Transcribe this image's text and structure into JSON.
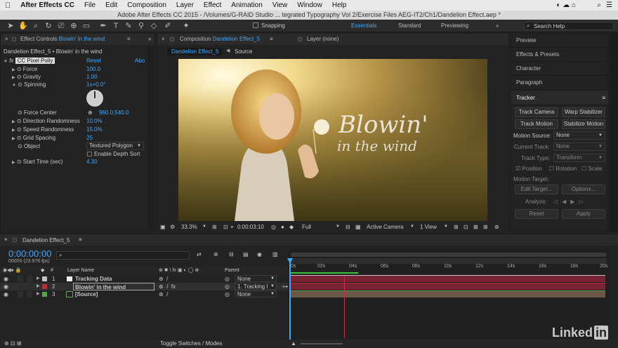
{
  "menu": {
    "app": "After Effects CC",
    "items": [
      "File",
      "Edit",
      "Composition",
      "Layer",
      "Effect",
      "Animation",
      "View",
      "Window",
      "Help"
    ]
  },
  "title_bar": "Adobe After Effects CC 2015 - /Volumes/G-RAID Studio ... tegrated Typography Vol 2/Exercise Files AEG-IT2/Ch1/Dandelion Effect.aep *",
  "toolbar": {
    "snapping_label": "Snapping",
    "workspaces": [
      "Essentials",
      "Standard",
      "Previewing"
    ],
    "search_placeholder": "Search Help"
  },
  "effect_controls": {
    "tab_label": "Effect Controls",
    "tab_layer": "Blowin' in the wind",
    "breadcrumb": "Dandelion Effect_5 • Blowin' in the wind",
    "effect_name": "CC Pixel Polly",
    "reset": "Reset",
    "about": "Abo",
    "props": [
      {
        "name": "Force",
        "value": "100.0"
      },
      {
        "name": "Gravity",
        "value": "1.00"
      },
      {
        "name": "Spinning",
        "value": "1x+0.0°"
      },
      {
        "name": "Force Center",
        "value": "960.0,540.0"
      },
      {
        "name": "Direction Randomness",
        "value": "10.0%"
      },
      {
        "name": "Speed Randomness",
        "value": "15.0%"
      },
      {
        "name": "Grid Spacing",
        "value": "25"
      },
      {
        "name": "Object",
        "value": "Textured Polygon"
      },
      {
        "name": "Enable Depth Sort",
        "value": ""
      },
      {
        "name": "Start Time (sec)",
        "value": "4.30"
      }
    ]
  },
  "composition": {
    "tab_label": "Composition",
    "tab_name": "Dandelion Effect_5",
    "layer_tab": "Layer (none)",
    "crumb_active": "Dandelion Effect_5",
    "crumb_source": "Source",
    "overlay_line1": "Blowin'",
    "overlay_line2": "in the wind",
    "zoom": "33.3%",
    "timecode": "0:00:03:10",
    "resolution": "Full",
    "camera": "Active Camera",
    "views": "1 View"
  },
  "right_panel": {
    "sections": [
      "Preview",
      "Effects & Presets",
      "Character",
      "Paragraph"
    ],
    "tracker_title": "Tracker",
    "buttons": {
      "track_camera": "Track Camera",
      "warp_stabilizer": "Warp Stabilizer",
      "track_motion": "Track Motion",
      "stabilize_motion": "Stabilize Motion",
      "edit_target": "Edit Target...",
      "options": "Options...",
      "reset": "Reset",
      "apply": "Apply"
    },
    "motion_source_label": "Motion Source:",
    "motion_source": "None",
    "current_track_label": "Current Track:",
    "current_track": "None",
    "track_type_label": "Track Type:",
    "track_type": "Transform",
    "position": "Position",
    "rotation": "Rotation",
    "scale": "Scale",
    "motion_target_label": "Motion Target:",
    "analyze_label": "Analyze:"
  },
  "timeline": {
    "tab_name": "Dandelion Effect_5",
    "timecode": "0:00:00:00",
    "frames": "00000 (23.976 fps)",
    "col_layer_name": "Layer Name",
    "col_parent": "Parent",
    "ruler": [
      "0s",
      "02s",
      "04s",
      "06s",
      "08s",
      "10s",
      "12s",
      "14s",
      "16s",
      "18s",
      "20s"
    ],
    "layers": [
      {
        "num": "1",
        "name": "Tracking Data",
        "parent": "None",
        "color": "#c2c2c2"
      },
      {
        "num": "2",
        "name": "Blowin' in the wind",
        "parent": "1. Tracking I",
        "color": "#b5303a"
      },
      {
        "num": "3",
        "name": "[Source]",
        "parent": "None",
        "color": "#5aa04f"
      }
    ],
    "toggle_label": "Toggle Switches / Modes"
  },
  "watermark": "Linked"
}
